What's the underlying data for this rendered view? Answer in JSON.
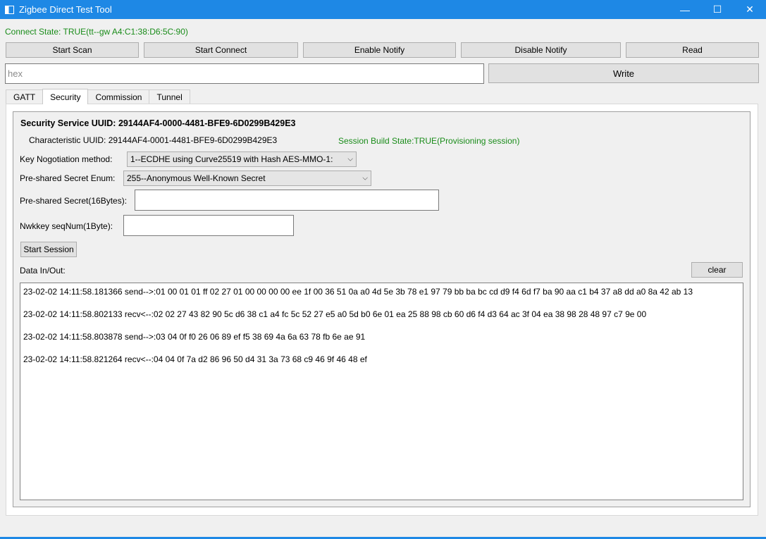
{
  "window": {
    "title": "Zigbee Direct Test Tool",
    "minimize": "—",
    "maximize": "☐",
    "close": "✕"
  },
  "connect_state": "Connect State: TRUE(tt--gw  A4:C1:38:D6:5C:90)",
  "toolbar": {
    "start_scan": "Start Scan",
    "start_connect": "Start Connect",
    "enable_notify": "Enable Notify",
    "disable_notify": "Disable Notify",
    "read": "Read",
    "write": "Write",
    "hex_placeholder": "hex",
    "hex_value": ""
  },
  "tabs": [
    "GATT",
    "Security",
    "Commission",
    "Tunnel"
  ],
  "active_tab": "Security",
  "security": {
    "service_uuid": "Security Service UUID: 29144AF4-0000-4481-BFE9-6D0299B429E3",
    "characteristic_uuid": "Characteristic UUID: 29144AF4-0001-4481-BFE9-6D0299B429E3",
    "session_state": "Session Build State:TRUE(Provisioning session)",
    "key_method_label": "Key Nogotiation method:",
    "key_method_value": "1--ECDHE using Curve25519 with Hash AES-MMO-1:",
    "psk_enum_label": "Pre-shared Secret Enum:",
    "psk_enum_value": "255--Anonymous Well-Known Secret",
    "psk_label": "Pre-shared Secret(16Bytes):",
    "psk_value": "",
    "nwk_seq_label": "Nwkkey seqNum(1Byte):",
    "nwk_seq_value": "",
    "start_session": "Start Session",
    "data_label": "Data In/Out:",
    "clear": "clear",
    "log": [
      "23-02-02 14:11:58.181366 send-->:01 00 01 01 ff 02 27 01 00 00 00 00 ee 1f 00 36 51 0a a0 4d 5e 3b 78 e1 97 79 bb ba bc cd d9 f4 6d f7 ba 90 aa c1 b4 37 a8 dd a0 8a 42 ab 13",
      "23-02-02 14:11:58.802133 recv<--:02 02 27 43 82 90 5c d6 38 c1 a4 fc 5c 52 27 e5 a0 5d b0 6e 01 ea 25 88 98 cb 60 d6 f4 d3 64 ac 3f 04 ea 38 98 28 48 97 c7 9e 00",
      "23-02-02 14:11:58.803878 send-->:03 04 0f f0 26 06 89 ef f5 38 69 4a 6a 63 78 fb 6e ae 91",
      "23-02-02 14:11:58.821264 recv<--:04 04 0f 7a d2 86 96 50 d4 31 3a 73 68 c9 46 9f 46 48 ef"
    ]
  },
  "colors": {
    "accent": "#1e88e5",
    "status_green": "#1a8c1a"
  }
}
